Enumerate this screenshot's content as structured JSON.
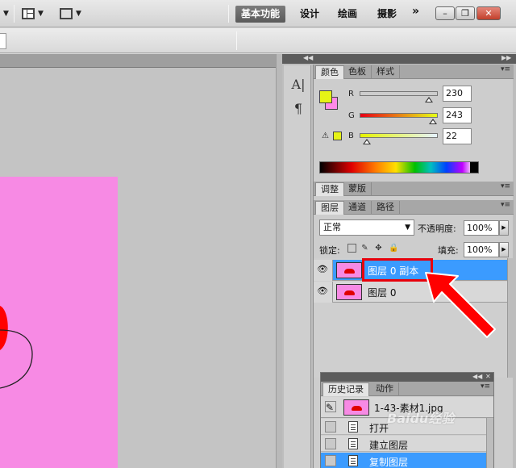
{
  "app_bar": {
    "workspaces": {
      "active": "基本功能",
      "design": "设计",
      "painting": "绘画",
      "photography": "摄影",
      "more": "»"
    },
    "window": {
      "minimize": "–",
      "restore": "❐",
      "close": "✕"
    }
  },
  "color_panel": {
    "tabs": [
      "颜色",
      "色板",
      "样式"
    ],
    "r_label": "R",
    "g_label": "G",
    "b_label": "B",
    "r": "230",
    "g": "243",
    "b": "22",
    "r_fraction": 0.9,
    "g_fraction": 0.95,
    "b_fraction": 0.09,
    "foreground": "#e6f316",
    "background": "#ff8ae8"
  },
  "adjust_tabs": [
    "调整",
    "蒙版"
  ],
  "layers_panel": {
    "tabs": [
      "图层",
      "通道",
      "路径"
    ],
    "blend_mode": "正常",
    "opacity_label": "不透明度:",
    "opacity": "100%",
    "lock_label": "锁定:",
    "fill_label": "填充:",
    "fill": "100%",
    "layers": [
      {
        "name": "图层 0 副本",
        "selected": true
      },
      {
        "name": "图层 0",
        "selected": false
      }
    ]
  },
  "history_panel": {
    "tabs": [
      "历史记录",
      "动作"
    ],
    "snapshot": "1-43-素材1.jpg",
    "steps": [
      {
        "label": "打开",
        "selected": false
      },
      {
        "label": "建立图层",
        "selected": false
      },
      {
        "label": "复制图层",
        "selected": true
      }
    ]
  },
  "canvas": {
    "color": "#f78ae4",
    "accent": "#e8000b",
    "highlight": "#3b9bff"
  },
  "watermark": "Baidu经验"
}
